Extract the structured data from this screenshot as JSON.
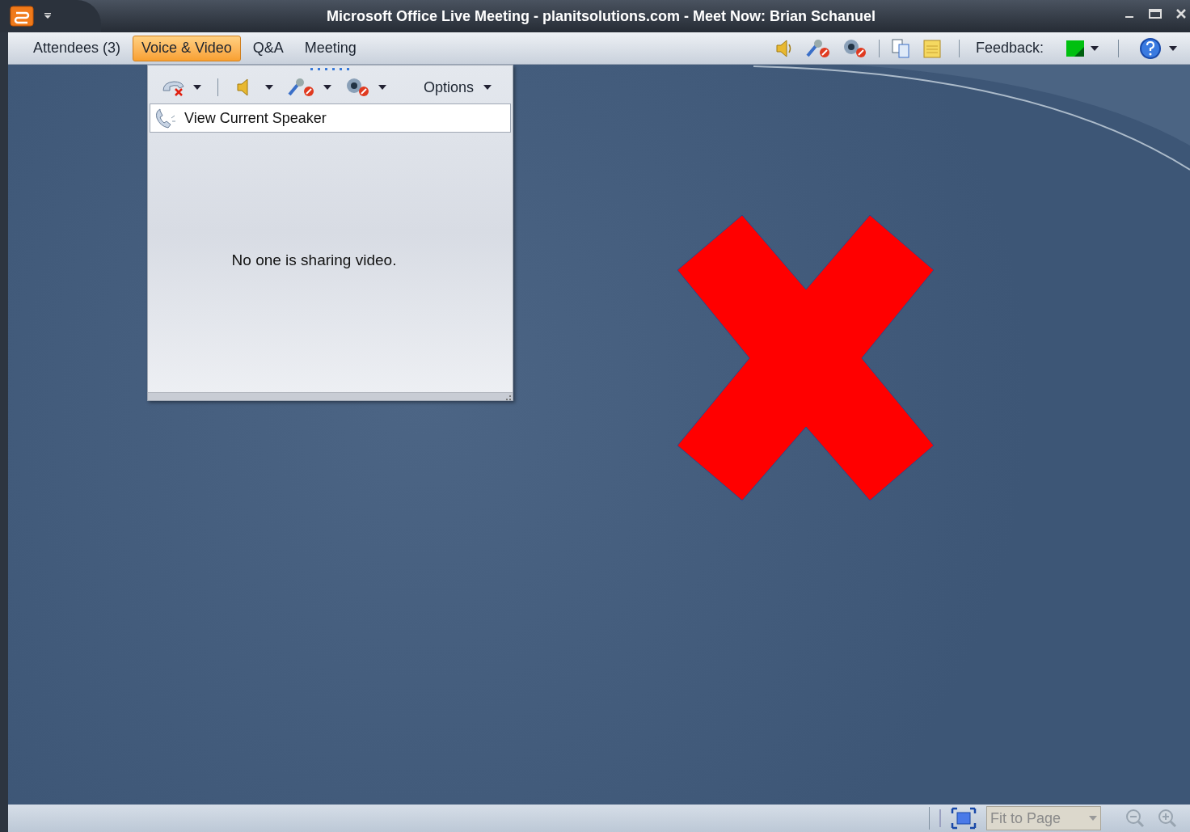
{
  "window": {
    "title": "Microsoft Office Live Meeting - planitsolutions.com - Meet Now: Brian Schanuel"
  },
  "tabs": [
    {
      "label": "Attendees (3)",
      "selected": false
    },
    {
      "label": "Voice & Video",
      "selected": true
    },
    {
      "label": "Q&A",
      "selected": false
    },
    {
      "label": "Meeting",
      "selected": false
    }
  ],
  "toolbar": {
    "feedback_label": "Feedback:"
  },
  "video_panel": {
    "options_label": "Options",
    "view_button": "View Current Speaker",
    "message": "No one is sharing video."
  },
  "status_bar": {
    "zoom_field": {
      "value": "Fit to Page",
      "disabled": true
    }
  }
}
